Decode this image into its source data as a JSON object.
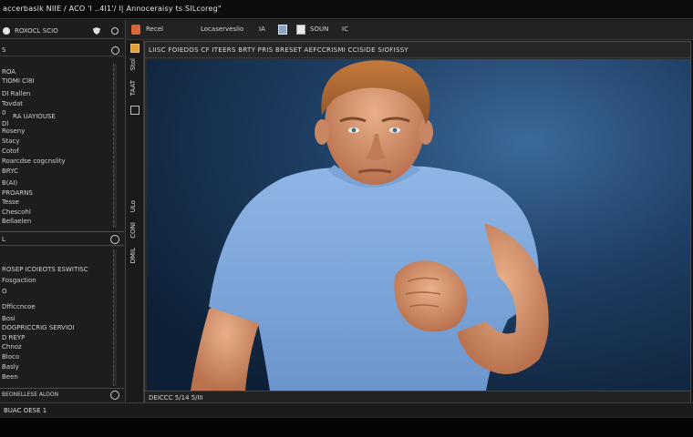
{
  "window": {
    "title": "accerbasik NIIE / ACO  'l  ..4I1'/  l|   Annoceraisy  ts  SILcoreg\""
  },
  "left_panel": {
    "header_label": "ROXOCL  SCIO",
    "sub_header_1": "S",
    "list_1": [
      "ROA",
      "TIOMI  Cl8I",
      "DI  Rallen",
      "Tovdat",
      "0",
      "RA  UAYIOUSE",
      "Dl",
      "Roseny",
      "Stacy",
      "Cotof",
      "Roarcdse  cogcnslity",
      "BRYC",
      "B(AI)",
      "PROARNS",
      "Tesse",
      "Chescohl",
      "Bellaelen"
    ],
    "divider_label": "L",
    "list_2": [
      "ROSEP  ICOIEOTS  ESWITISC",
      "Fosgaction",
      "O",
      "Dfficcncoe",
      "Bosi",
      "DOGPRICCRIG  SERVIOI",
      "D  REYP",
      "Chnoz",
      "Bloco",
      "Basly",
      "Been"
    ],
    "bottom_label": "BEONELLESE  ALOON"
  },
  "toolbar": {
    "tabs": [
      "Recel",
      "Locaserveslio",
      "IA",
      "SOUN",
      "IC"
    ]
  },
  "tool_strip": {
    "vertical_labels": [
      "Stol",
      "TAAT",
      "ULo",
      "CONI",
      "DMIL"
    ]
  },
  "document": {
    "header_label": "LIISC  FOIEDOS  CF  ITEERS  BRTY  PRIS  BRESET  AEFCCRISMI  CCISIDE  SIOFISSY",
    "footer_label": "DEICCC  5/14  5/III",
    "photo_subject": "man-in-blue-tshirt"
  },
  "status_bar": {
    "label": "BUAC  OESE  1"
  },
  "colors": {
    "background": "#161616",
    "panel": "#1d1d1d",
    "canvas_bg": "#1e3e63",
    "shirt": "#7fa8dc",
    "skin": "#d89a74",
    "hair": "#b06a34"
  }
}
